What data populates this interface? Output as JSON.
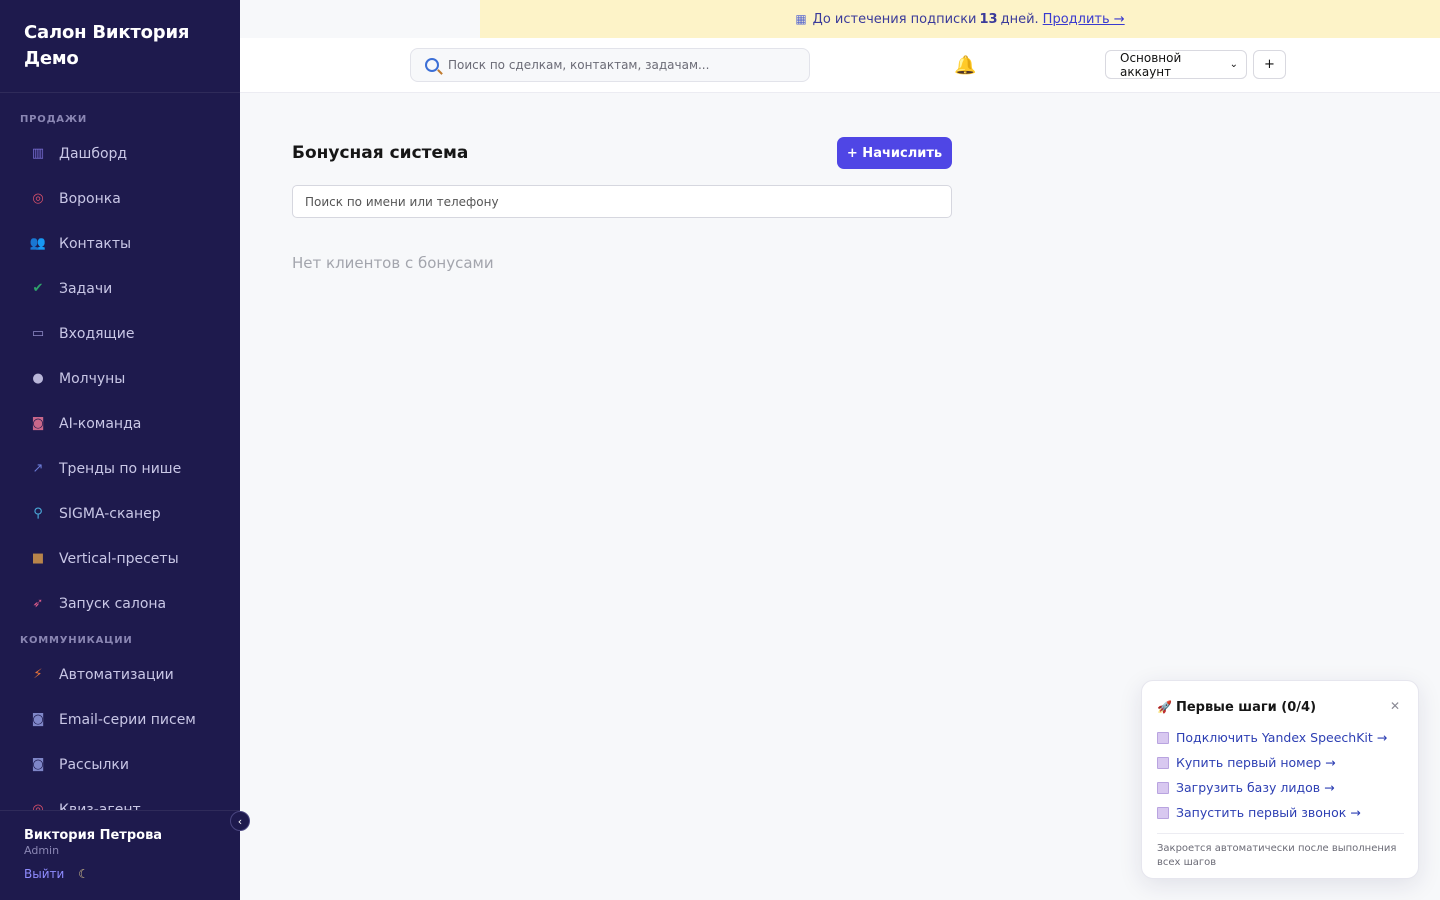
{
  "app": {
    "brand_title": "Салон Виктория Демо"
  },
  "sidebar": {
    "sections": [
      {
        "label": "ПРОДАЖИ",
        "items": [
          {
            "label": "Дашборд",
            "icon": "chart-bar-icon",
            "icon_glyph": "▥",
            "icon_color": "#7a6fd6"
          },
          {
            "label": "Воронка",
            "icon": "target-icon",
            "icon_glyph": "◎",
            "icon_color": "#d9506a"
          },
          {
            "label": "Контакты",
            "icon": "users-icon",
            "icon_glyph": "👥",
            "icon_color": "#6b5fb5"
          },
          {
            "label": "Задачи",
            "icon": "checkbox-icon",
            "icon_glyph": "✔",
            "icon_color": "#2fa36b"
          },
          {
            "label": "Входящие",
            "icon": "inbox-icon",
            "icon_glyph": "▭",
            "icon_color": "#8f8cc8"
          },
          {
            "label": "Молчуны",
            "icon": "speech-bubble-icon",
            "icon_glyph": "●",
            "icon_color": "#b9b6d9"
          },
          {
            "label": "AI-команда",
            "icon": "robot-icon",
            "icon_glyph": "◙",
            "icon_color": "#c9678a"
          },
          {
            "label": "Тренды по нише",
            "icon": "trend-chart-icon",
            "icon_glyph": "↗",
            "icon_color": "#6b7bd6"
          },
          {
            "label": "SIGMA-сканер",
            "icon": "magnifier-icon",
            "icon_glyph": "⚲",
            "icon_color": "#4aa8d8"
          },
          {
            "label": "Vertical-пресеты",
            "icon": "package-icon",
            "icon_glyph": "■",
            "icon_color": "#b8844a"
          },
          {
            "label": "Запуск салона",
            "icon": "rocket-icon",
            "icon_glyph": "➶",
            "icon_color": "#d95a8a"
          }
        ]
      },
      {
        "label": "КОММУНИКАЦИИ",
        "items": [
          {
            "label": "Автоматизации",
            "icon": "lightning-icon",
            "icon_glyph": "⚡",
            "icon_color": "#e8743a"
          },
          {
            "label": "Email-серии писем",
            "icon": "email-icon",
            "icon_glyph": "◙",
            "icon_color": "#7f86c8"
          },
          {
            "label": "Рассылки",
            "icon": "mail-icon",
            "icon_glyph": "◙",
            "icon_color": "#7f86c8"
          },
          {
            "label": "Квиз-агент",
            "icon": "quiz-target-icon",
            "icon_glyph": "◎",
            "icon_color": "#d9506a"
          }
        ]
      }
    ],
    "user": {
      "name": "Виктория Петрова",
      "role": "Admin",
      "logout_label": "Выйти"
    },
    "collapse_glyph": "‹"
  },
  "banner": {
    "text_before": "До истечения подписки",
    "days": "13",
    "text_after": "дней.",
    "link": "Продлить →"
  },
  "header": {
    "search_placeholder": "Поиск по сделкам, контактам, задачам...",
    "account_selected": "Основной аккаунт",
    "plus_label": "+"
  },
  "main": {
    "title": "Бонусная система",
    "accrue_button": "+ Начислить",
    "client_search_placeholder": "Поиск по имени или телефону",
    "empty_text": "Нет клиентов с бонусами"
  },
  "onboarding": {
    "title": "Первые шаги (0/4)",
    "steps": [
      "Подключить Yandex SpeechKit →",
      "Купить первый номер →",
      "Загрузить базу лидов →",
      "Запустить первый звонок →"
    ],
    "note": "Закроется автоматически после выполнения всех шагов"
  },
  "colors": {
    "sidebar_bg": "#1e1a4d",
    "accent": "#4f46e5",
    "banner_bg": "#fdf3c8",
    "link": "#2d3fb3"
  }
}
